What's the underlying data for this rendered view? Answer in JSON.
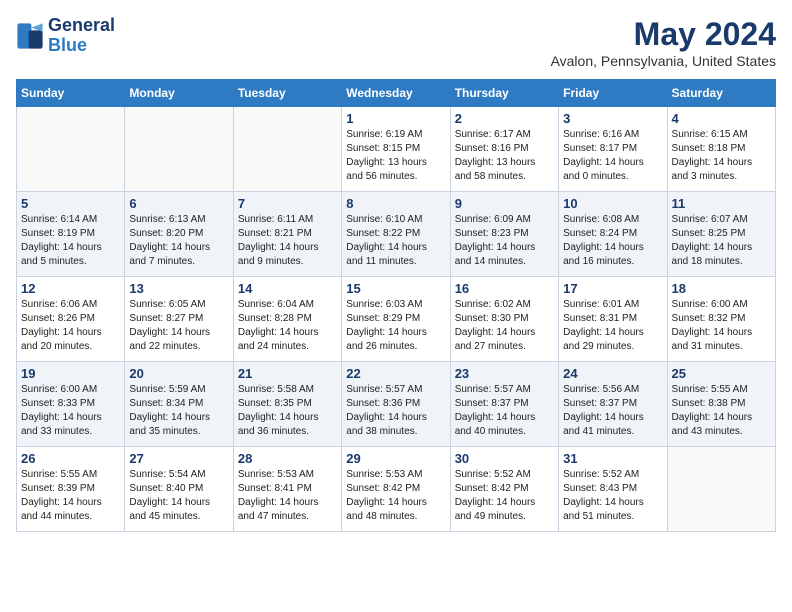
{
  "header": {
    "logo_line1": "General",
    "logo_line2": "Blue",
    "main_title": "May 2024",
    "sub_title": "Avalon, Pennsylvania, United States"
  },
  "weekdays": [
    "Sunday",
    "Monday",
    "Tuesday",
    "Wednesday",
    "Thursday",
    "Friday",
    "Saturday"
  ],
  "weeks": [
    [
      {
        "day": "",
        "sunrise": "",
        "sunset": "",
        "daylight": ""
      },
      {
        "day": "",
        "sunrise": "",
        "sunset": "",
        "daylight": ""
      },
      {
        "day": "",
        "sunrise": "",
        "sunset": "",
        "daylight": ""
      },
      {
        "day": "1",
        "sunrise": "Sunrise: 6:19 AM",
        "sunset": "Sunset: 8:15 PM",
        "daylight": "Daylight: 13 hours and 56 minutes."
      },
      {
        "day": "2",
        "sunrise": "Sunrise: 6:17 AM",
        "sunset": "Sunset: 8:16 PM",
        "daylight": "Daylight: 13 hours and 58 minutes."
      },
      {
        "day": "3",
        "sunrise": "Sunrise: 6:16 AM",
        "sunset": "Sunset: 8:17 PM",
        "daylight": "Daylight: 14 hours and 0 minutes."
      },
      {
        "day": "4",
        "sunrise": "Sunrise: 6:15 AM",
        "sunset": "Sunset: 8:18 PM",
        "daylight": "Daylight: 14 hours and 3 minutes."
      }
    ],
    [
      {
        "day": "5",
        "sunrise": "Sunrise: 6:14 AM",
        "sunset": "Sunset: 8:19 PM",
        "daylight": "Daylight: 14 hours and 5 minutes."
      },
      {
        "day": "6",
        "sunrise": "Sunrise: 6:13 AM",
        "sunset": "Sunset: 8:20 PM",
        "daylight": "Daylight: 14 hours and 7 minutes."
      },
      {
        "day": "7",
        "sunrise": "Sunrise: 6:11 AM",
        "sunset": "Sunset: 8:21 PM",
        "daylight": "Daylight: 14 hours and 9 minutes."
      },
      {
        "day": "8",
        "sunrise": "Sunrise: 6:10 AM",
        "sunset": "Sunset: 8:22 PM",
        "daylight": "Daylight: 14 hours and 11 minutes."
      },
      {
        "day": "9",
        "sunrise": "Sunrise: 6:09 AM",
        "sunset": "Sunset: 8:23 PM",
        "daylight": "Daylight: 14 hours and 14 minutes."
      },
      {
        "day": "10",
        "sunrise": "Sunrise: 6:08 AM",
        "sunset": "Sunset: 8:24 PM",
        "daylight": "Daylight: 14 hours and 16 minutes."
      },
      {
        "day": "11",
        "sunrise": "Sunrise: 6:07 AM",
        "sunset": "Sunset: 8:25 PM",
        "daylight": "Daylight: 14 hours and 18 minutes."
      }
    ],
    [
      {
        "day": "12",
        "sunrise": "Sunrise: 6:06 AM",
        "sunset": "Sunset: 8:26 PM",
        "daylight": "Daylight: 14 hours and 20 minutes."
      },
      {
        "day": "13",
        "sunrise": "Sunrise: 6:05 AM",
        "sunset": "Sunset: 8:27 PM",
        "daylight": "Daylight: 14 hours and 22 minutes."
      },
      {
        "day": "14",
        "sunrise": "Sunrise: 6:04 AM",
        "sunset": "Sunset: 8:28 PM",
        "daylight": "Daylight: 14 hours and 24 minutes."
      },
      {
        "day": "15",
        "sunrise": "Sunrise: 6:03 AM",
        "sunset": "Sunset: 8:29 PM",
        "daylight": "Daylight: 14 hours and 26 minutes."
      },
      {
        "day": "16",
        "sunrise": "Sunrise: 6:02 AM",
        "sunset": "Sunset: 8:30 PM",
        "daylight": "Daylight: 14 hours and 27 minutes."
      },
      {
        "day": "17",
        "sunrise": "Sunrise: 6:01 AM",
        "sunset": "Sunset: 8:31 PM",
        "daylight": "Daylight: 14 hours and 29 minutes."
      },
      {
        "day": "18",
        "sunrise": "Sunrise: 6:00 AM",
        "sunset": "Sunset: 8:32 PM",
        "daylight": "Daylight: 14 hours and 31 minutes."
      }
    ],
    [
      {
        "day": "19",
        "sunrise": "Sunrise: 6:00 AM",
        "sunset": "Sunset: 8:33 PM",
        "daylight": "Daylight: 14 hours and 33 minutes."
      },
      {
        "day": "20",
        "sunrise": "Sunrise: 5:59 AM",
        "sunset": "Sunset: 8:34 PM",
        "daylight": "Daylight: 14 hours and 35 minutes."
      },
      {
        "day": "21",
        "sunrise": "Sunrise: 5:58 AM",
        "sunset": "Sunset: 8:35 PM",
        "daylight": "Daylight: 14 hours and 36 minutes."
      },
      {
        "day": "22",
        "sunrise": "Sunrise: 5:57 AM",
        "sunset": "Sunset: 8:36 PM",
        "daylight": "Daylight: 14 hours and 38 minutes."
      },
      {
        "day": "23",
        "sunrise": "Sunrise: 5:57 AM",
        "sunset": "Sunset: 8:37 PM",
        "daylight": "Daylight: 14 hours and 40 minutes."
      },
      {
        "day": "24",
        "sunrise": "Sunrise: 5:56 AM",
        "sunset": "Sunset: 8:37 PM",
        "daylight": "Daylight: 14 hours and 41 minutes."
      },
      {
        "day": "25",
        "sunrise": "Sunrise: 5:55 AM",
        "sunset": "Sunset: 8:38 PM",
        "daylight": "Daylight: 14 hours and 43 minutes."
      }
    ],
    [
      {
        "day": "26",
        "sunrise": "Sunrise: 5:55 AM",
        "sunset": "Sunset: 8:39 PM",
        "daylight": "Daylight: 14 hours and 44 minutes."
      },
      {
        "day": "27",
        "sunrise": "Sunrise: 5:54 AM",
        "sunset": "Sunset: 8:40 PM",
        "daylight": "Daylight: 14 hours and 45 minutes."
      },
      {
        "day": "28",
        "sunrise": "Sunrise: 5:53 AM",
        "sunset": "Sunset: 8:41 PM",
        "daylight": "Daylight: 14 hours and 47 minutes."
      },
      {
        "day": "29",
        "sunrise": "Sunrise: 5:53 AM",
        "sunset": "Sunset: 8:42 PM",
        "daylight": "Daylight: 14 hours and 48 minutes."
      },
      {
        "day": "30",
        "sunrise": "Sunrise: 5:52 AM",
        "sunset": "Sunset: 8:42 PM",
        "daylight": "Daylight: 14 hours and 49 minutes."
      },
      {
        "day": "31",
        "sunrise": "Sunrise: 5:52 AM",
        "sunset": "Sunset: 8:43 PM",
        "daylight": "Daylight: 14 hours and 51 minutes."
      },
      {
        "day": "",
        "sunrise": "",
        "sunset": "",
        "daylight": ""
      }
    ]
  ]
}
